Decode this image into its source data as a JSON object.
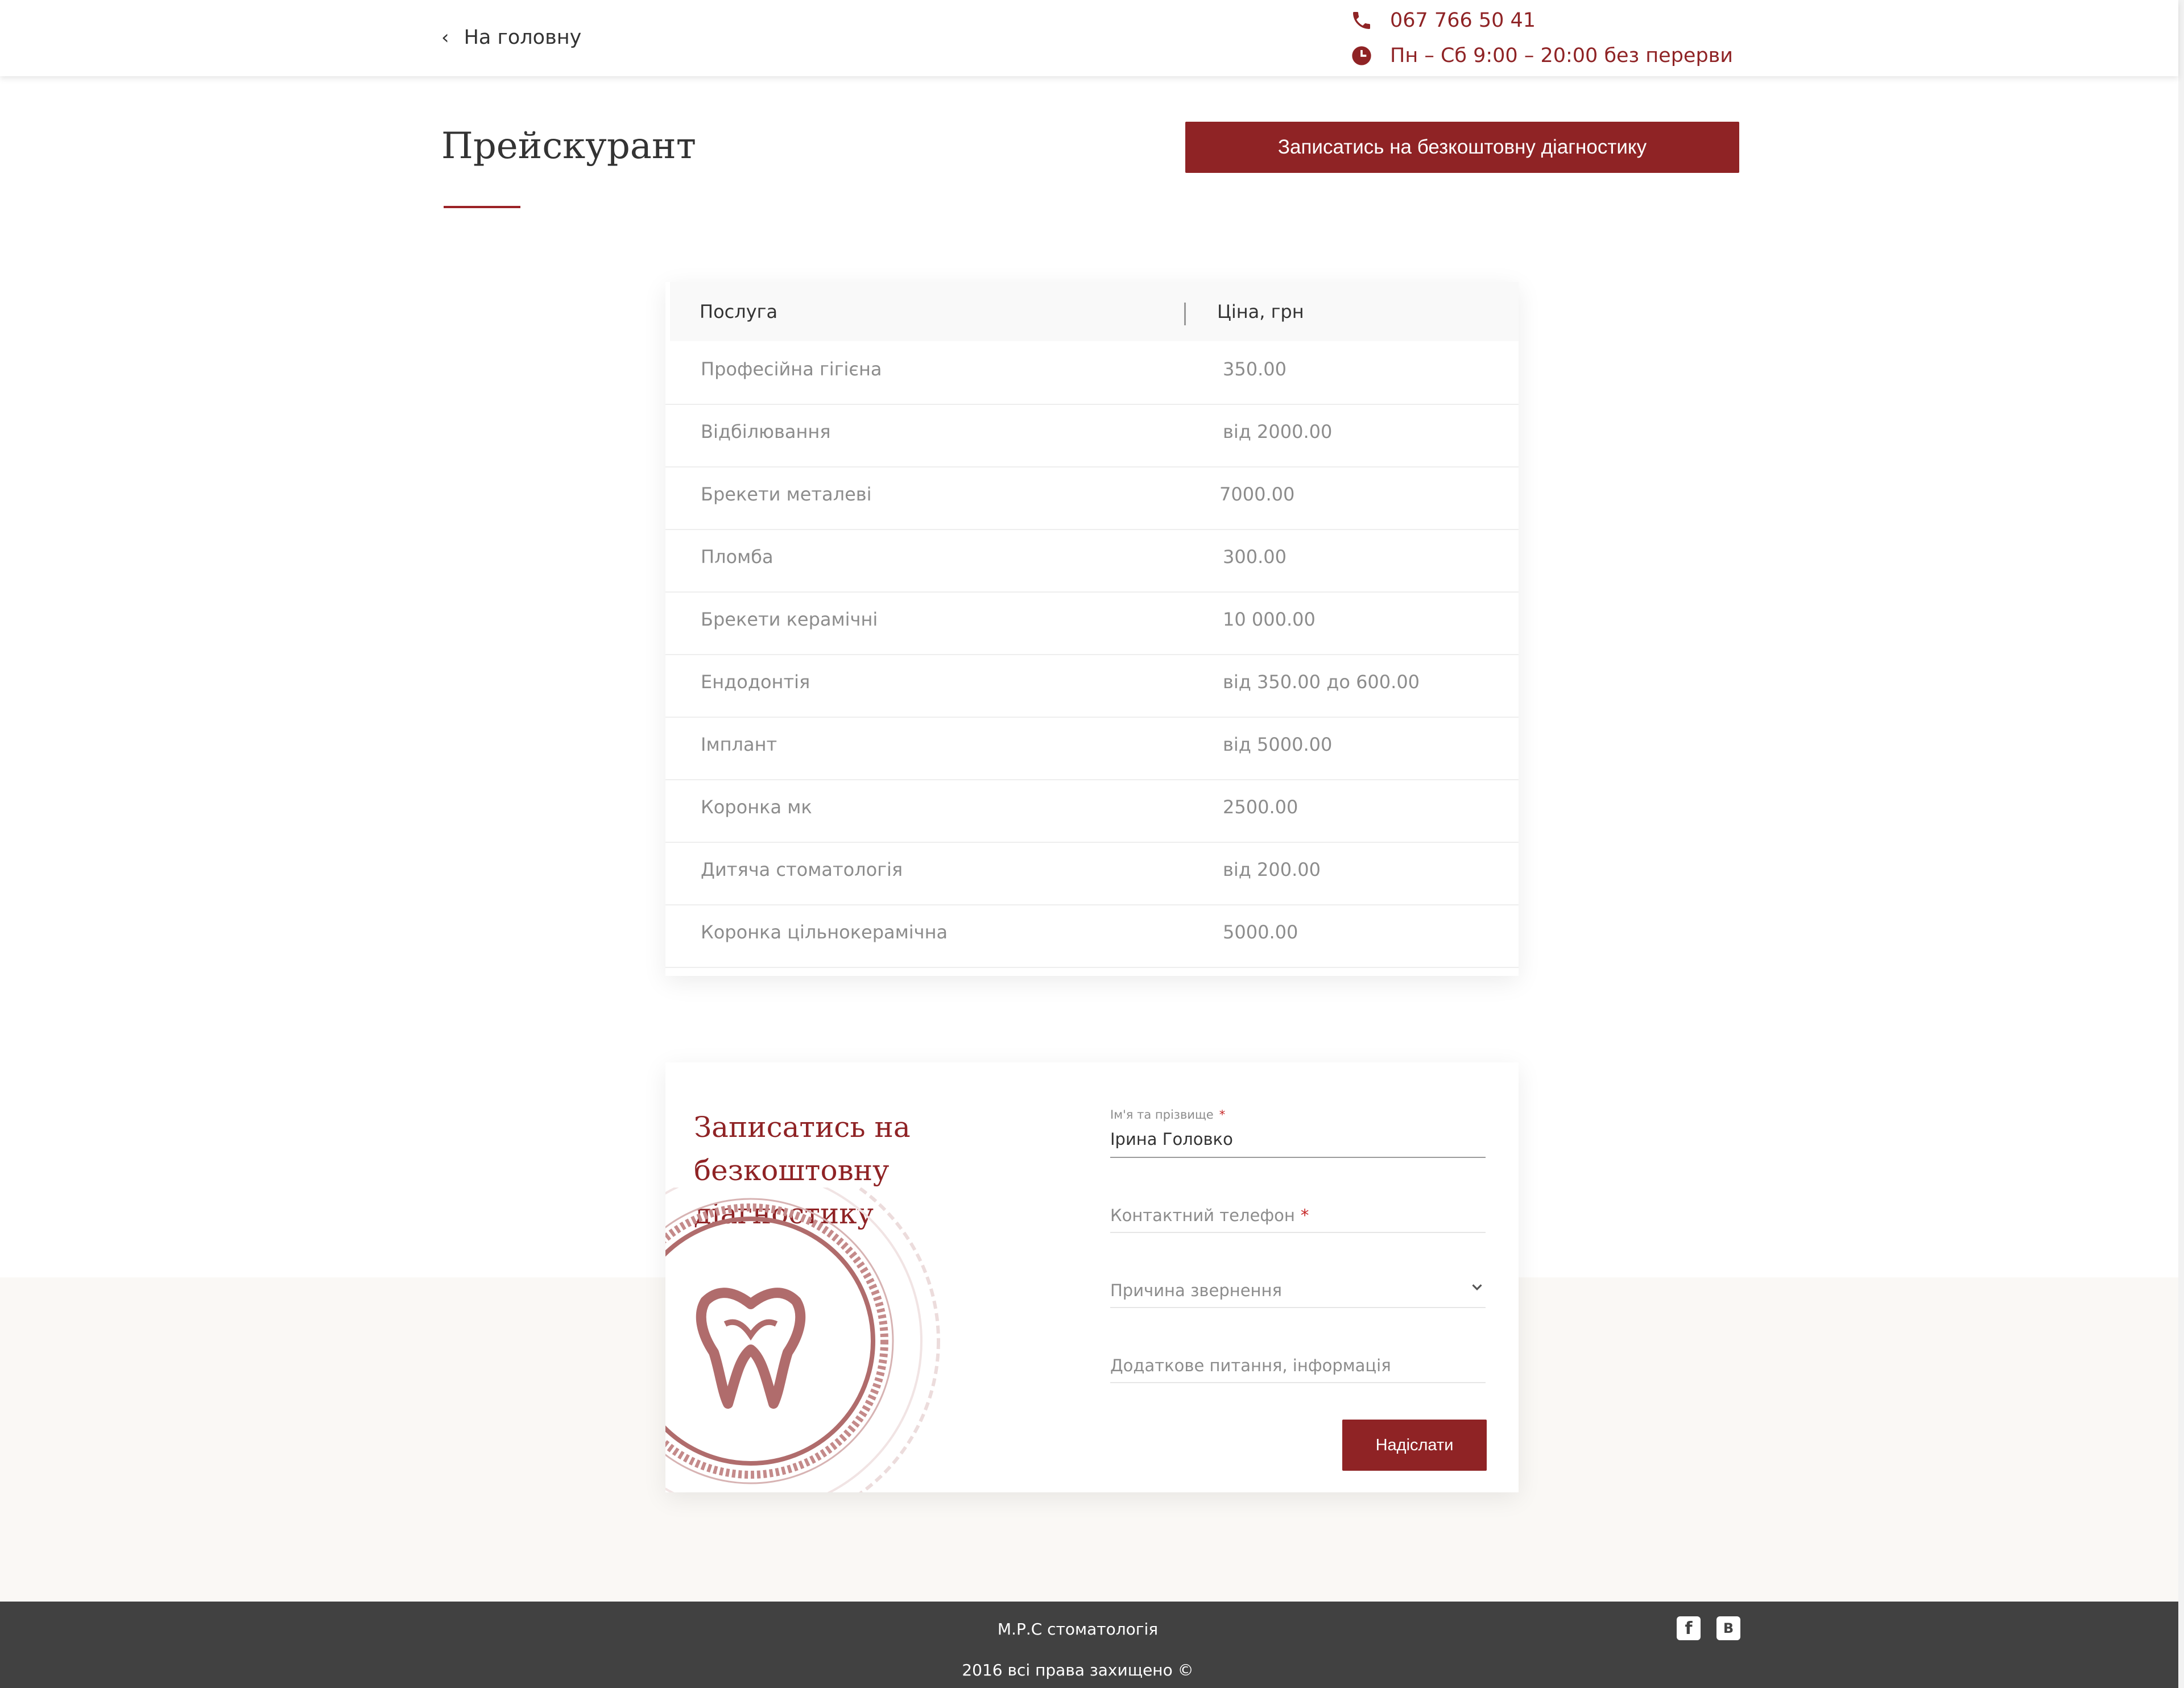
{
  "header": {
    "back_label": "На головну",
    "phone": "067 766 50 41",
    "hours": "Пн – Сб 9:00 – 20:00 без перерви"
  },
  "page": {
    "title": "Прейскурант",
    "cta_label": "Записатись на безкоштовну діагностику"
  },
  "price_table": {
    "headers": [
      "Послуга",
      "Ціна, грн"
    ],
    "rows": [
      {
        "service": "Професійна гігієна",
        "price": "350.00"
      },
      {
        "service": "Відбілювання",
        "price": "від 2000.00"
      },
      {
        "service": "Брекети металеві",
        "price": "7000.00"
      },
      {
        "service": "Пломба",
        "price": "300.00"
      },
      {
        "service": "Брекети керамічні",
        "price": "10 000.00"
      },
      {
        "service": "Ендодонтія",
        "price": "від 350.00 до 600.00"
      },
      {
        "service": "Імплант",
        "price": "від 5000.00"
      },
      {
        "service": "Коронка мк",
        "price": "2500.00"
      },
      {
        "service": "Дитяча стоматологія",
        "price": "від 200.00"
      },
      {
        "service": "Коронка цільнокерамічна",
        "price": "5000.00"
      }
    ]
  },
  "form": {
    "title": "Записатись на безкоштовну діагностику",
    "name_label": "Ім'я та прізвище",
    "name_value": "Ірина Головко",
    "phone_placeholder": "Контактний телефон",
    "reason_placeholder": "Причина звернення",
    "extra_placeholder": "Додаткове питання, інформація",
    "required_mark": "*",
    "submit_label": "Надіслати"
  },
  "footer": {
    "brand": "М.Р.С стоматологія",
    "copyright": "2016 всі права захищено ©",
    "social": [
      {
        "icon": "facebook-icon",
        "glyph": "f"
      },
      {
        "icon": "vk-icon",
        "glyph": "В"
      }
    ]
  },
  "colors": {
    "accent": "#8f2325",
    "footer_bg": "#414141",
    "band_bg": "#faf8f5"
  }
}
